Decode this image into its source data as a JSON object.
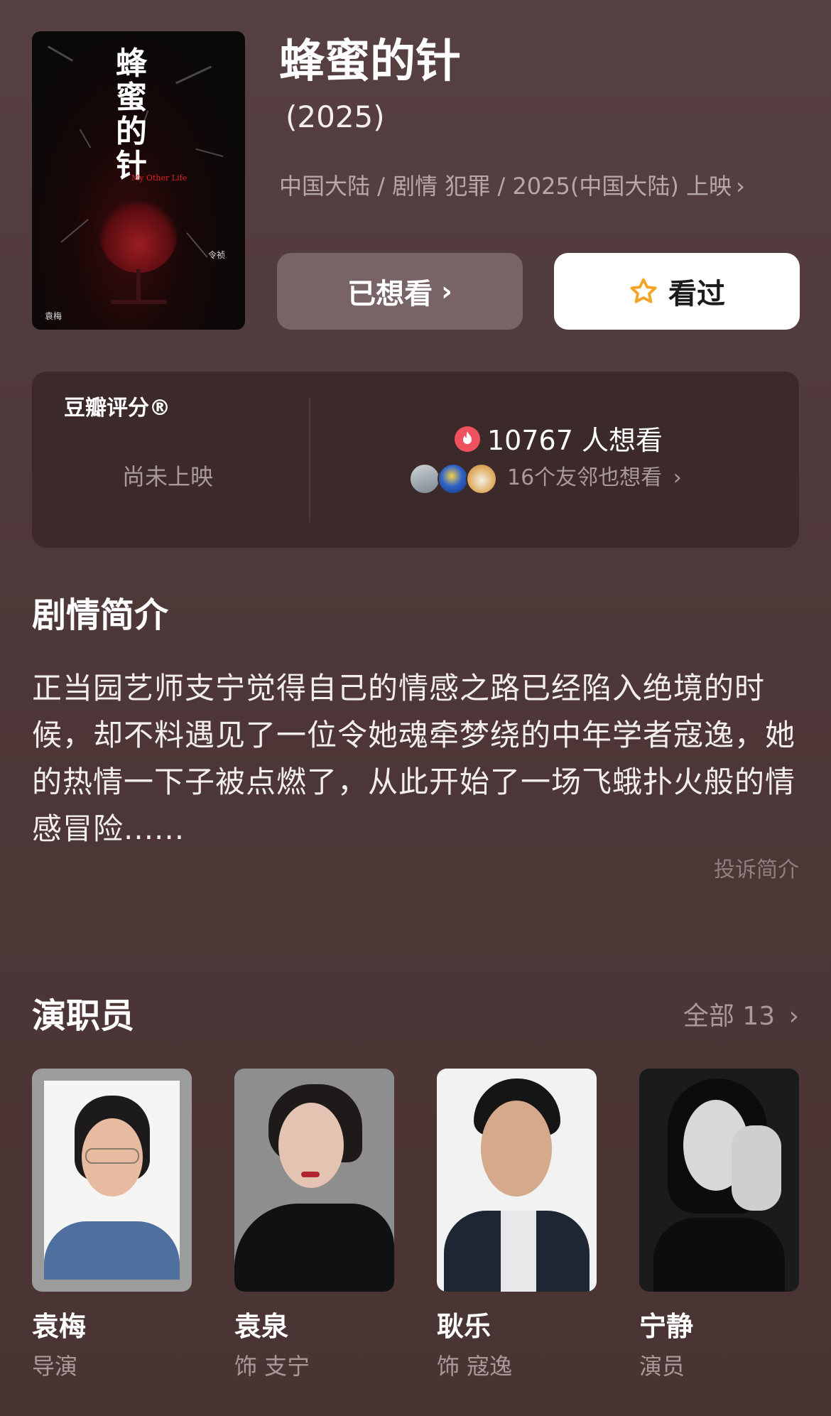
{
  "movie": {
    "title": "蜂蜜的针",
    "year": "(2025)",
    "meta": "中国大陆 / 剧情 犯罪 / 2025(中国大陆) 上映",
    "poster": {
      "title_lines": [
        "蜂",
        "蜜",
        "的",
        "针"
      ],
      "subtitle": "My Other Life",
      "credit_left": "袁梅",
      "credit_right": "令祯"
    }
  },
  "actions": {
    "want_label": "已想看",
    "watched_label": "看过",
    "accent": "#f2a524"
  },
  "rating": {
    "label": "豆瓣评分®",
    "status": "尚未上映",
    "want_count": "10767 人想看",
    "friends": "16个友邻也想看"
  },
  "synopsis": {
    "heading": "剧情简介",
    "text": "正当园艺师支宁觉得自己的情感之路已经陷入绝境的时候，却不料遇见了一位令她魂牵梦绕的中年学者寇逸，她的热情一下子被点燃了，从此开始了一场飞蛾扑火般的情感冒险......",
    "report": "投诉简介"
  },
  "cast": {
    "heading": "演职员",
    "all_label": "全部 13",
    "members": [
      {
        "name": "袁梅",
        "role": "导演"
      },
      {
        "name": "袁泉",
        "role": "饰 支宁"
      },
      {
        "name": "耿乐",
        "role": "饰 寇逸"
      },
      {
        "name": "宁静",
        "role": "演员"
      }
    ]
  },
  "colors": {
    "background": "#4e3738",
    "card": "#3c2a2b",
    "fire": "#f0515e",
    "muted_text": "#a99999"
  }
}
